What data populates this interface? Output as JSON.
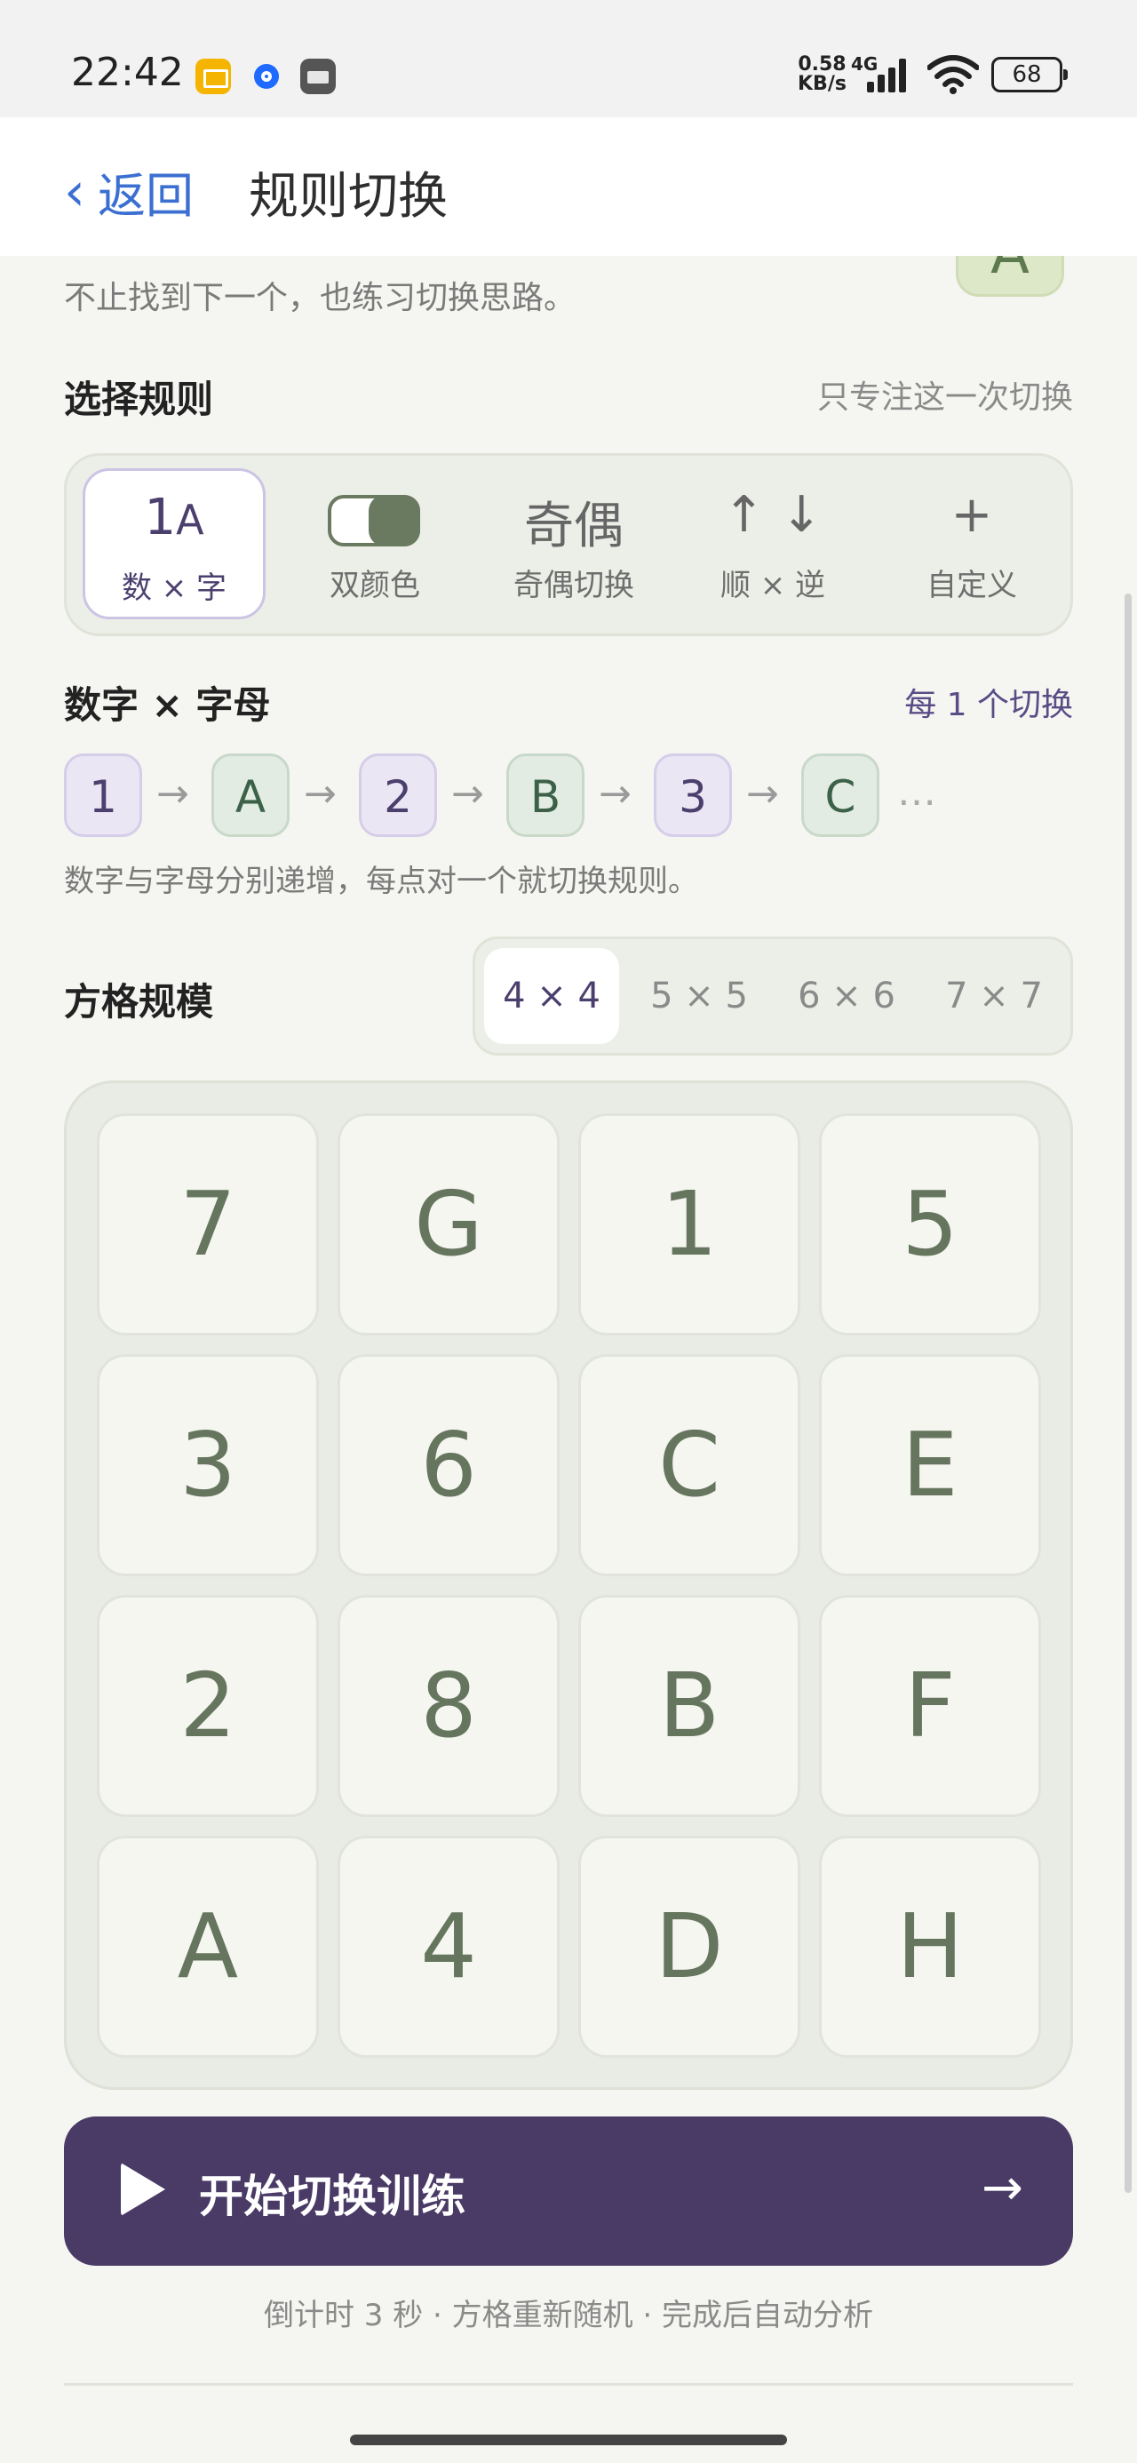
{
  "status_bar": {
    "time": "22:42",
    "app_icons": [
      "mail-app-icon",
      "chat-app-icon",
      "mt-app-icon"
    ],
    "net_speed_value": "0.58",
    "net_speed_unit": "KB/s",
    "network": "4G",
    "battery": "68"
  },
  "nav": {
    "back_label": "返回",
    "title": "规则切换"
  },
  "intro": {
    "subtitle": "不止找到下一个，也练习切换思路。",
    "peek_badge": "A"
  },
  "rule_section": {
    "title": "选择规则",
    "hint": "只专注这一次切换",
    "options": [
      {
        "icon_main": "1",
        "icon_small": "A",
        "label": "数 × 字",
        "active": true
      },
      {
        "icon_main": "",
        "icon_small": "",
        "label": "双颜色",
        "active": false
      },
      {
        "icon_main": "奇偶",
        "icon_small": "",
        "label": "奇偶切换",
        "active": false
      },
      {
        "icon_main": "↑ ↓",
        "icon_small": "",
        "label": "顺 × 逆",
        "active": false
      },
      {
        "icon_main": "+",
        "icon_small": "",
        "label": "自定义",
        "active": false
      }
    ]
  },
  "rule_detail": {
    "title": "数字 × 字母",
    "hint": "每 1 个切换",
    "sequence": [
      "1",
      "A",
      "2",
      "B",
      "3",
      "C"
    ],
    "arrow": "→",
    "more": "…",
    "description": "数字与字母分别递增，每点对一个就切换规则。"
  },
  "grid_size": {
    "title": "方格规模",
    "options": [
      "4 × 4",
      "5 × 5",
      "6 × 6",
      "7 × 7"
    ],
    "selected": "4 × 4"
  },
  "board": {
    "cells": [
      "7",
      "G",
      "1",
      "5",
      "3",
      "6",
      "C",
      "E",
      "2",
      "8",
      "B",
      "F",
      "A",
      "4",
      "D",
      "H"
    ]
  },
  "start": {
    "label": "开始切换训练",
    "arrow": "→"
  },
  "footer_hint": "倒计时 3 秒 · 方格重新随机 · 完成后自动分析",
  "colors": {
    "accent": "#4a3a66",
    "link": "#3b6fd1",
    "cell_text": "#66765e",
    "background": "#f5f6f1"
  }
}
